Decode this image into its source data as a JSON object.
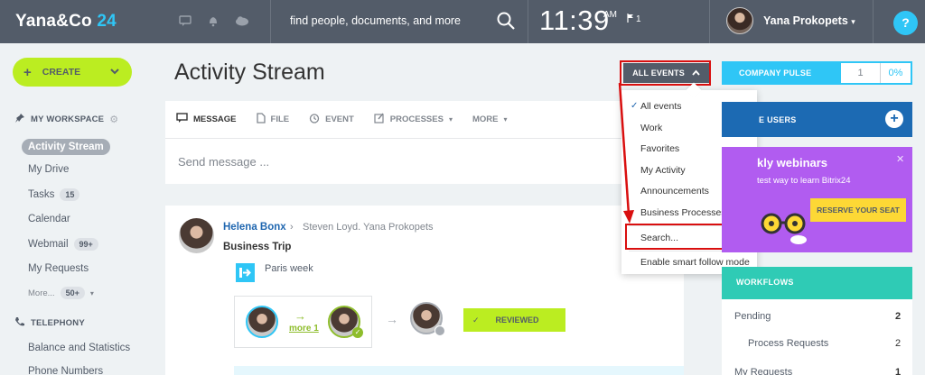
{
  "header": {
    "logo_text": "Yana&Co",
    "logo_number": "24",
    "search_placeholder": "find people, documents, and more",
    "time": "11:39",
    "ampm": "AM",
    "flag_count": "1",
    "user_name": "Yana Prokopets",
    "help_label": "?"
  },
  "sidebar": {
    "create_label": "CREATE",
    "workspace_label": "MY WORKSPACE",
    "items": [
      {
        "label": "Activity Stream",
        "count": ""
      },
      {
        "label": "My Drive",
        "count": ""
      },
      {
        "label": "Tasks",
        "count": "15"
      },
      {
        "label": "Calendar",
        "count": ""
      },
      {
        "label": "Webmail",
        "count": "99+"
      },
      {
        "label": "My Requests",
        "count": ""
      },
      {
        "label": "More...",
        "count": "50+"
      }
    ],
    "telephony_label": "TELEPHONY",
    "telephony_items": [
      "Balance and Statistics",
      "Phone Numbers"
    ]
  },
  "main": {
    "title": "Activity Stream",
    "filter_button": "ALL EVENTS",
    "composer_tabs": [
      "MESSAGE",
      "FILE",
      "EVENT",
      "PROCESSES",
      "MORE"
    ],
    "composer_placeholder": "Send message ...",
    "post": {
      "author": "Helena Bonx",
      "recipients": "Steven Loyd. Yana Prokopets",
      "title": "Business Trip",
      "attachment": "Paris week",
      "more_link": "more 1",
      "action_button": "REVIEWED"
    }
  },
  "dropdown": {
    "items": [
      "All events",
      "Work",
      "Favorites",
      "My Activity",
      "Announcements",
      "Business Processes"
    ],
    "search_item": "Search...",
    "smart_follow": "Enable smart follow mode",
    "selected_index": 0
  },
  "right": {
    "pulse_label": "COMPANY PULSE",
    "pulse_count": "1",
    "pulse_percent": "0%",
    "invite_label": "E USERS",
    "webinar_title": "kly webinars",
    "webinar_sub": "test way to learn Bitrix24",
    "reserve_label": "RESERVE YOUR SEAT",
    "workflows_label": "WORKFLOWS",
    "workflow_rows": [
      {
        "label": "Pending",
        "count": "2"
      },
      {
        "label": "Process Requests",
        "count": "2"
      },
      {
        "label": "My Requests",
        "count": "1"
      }
    ]
  },
  "colors": {
    "accent_blue": "#2fc6f6",
    "topbar": "#535c69",
    "create_green": "#bbed21",
    "annotation_red": "#d90f0f"
  }
}
